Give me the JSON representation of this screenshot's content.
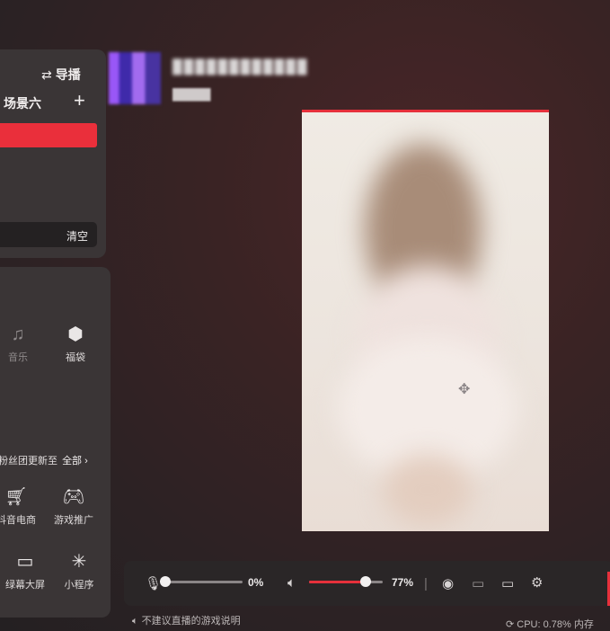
{
  "scene_panel": {
    "guide_label": "导播",
    "scene_name": "场景六",
    "add_icon": "plus-icon",
    "clear_label": "清空"
  },
  "tools": {
    "music_label": "音乐",
    "lucky_bag_label": "福袋",
    "fans_text": "粉丝团更新至",
    "all_label": "全部",
    "ecommerce_label": "抖音电商",
    "game_promo_label": "游戏推广",
    "big_screen_label": "绿幕大屏",
    "mini_program_label": "小程序"
  },
  "stream": {
    "title": "████████████",
    "category": "█████"
  },
  "controls": {
    "mic_value": "0%",
    "mic_level": 0,
    "volume_value": "77%",
    "volume_level": 0.77,
    "accent": "#e6303b"
  },
  "footer": {
    "note": "不建议直播的游戏说明",
    "cpu": "CPU: 0.78%",
    "cpu_suffix": "内存"
  }
}
